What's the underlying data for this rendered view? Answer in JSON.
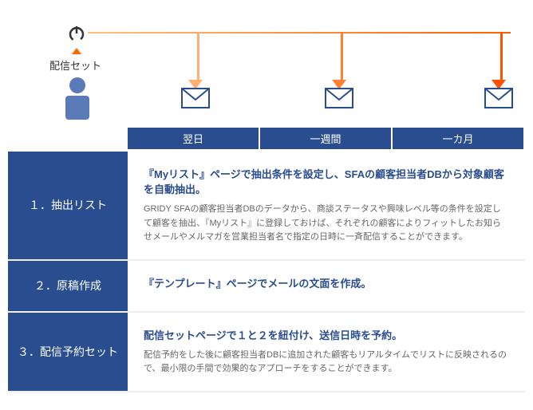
{
  "header": {
    "set_label": "配信セット",
    "timeline": [
      "翌日",
      "一週間",
      "一カ月"
    ]
  },
  "steps": [
    {
      "label": "１．抽出リスト",
      "title": "『Myリスト』ページで抽出条件を設定し、SFAの顧客担当者DBから対象顧客を自動抽出。",
      "desc": "GRIDY SFAの顧客担当者DBのデータから、商談ステータスや興味レベル等の条件を設定して顧客を抽出、『Myリスト』に登録しておけば、それぞれの顧客によりフィットしたお知らせメールやメルマガを営業担当者名で指定の日時に一斉配信することができます。"
    },
    {
      "label": "２．原稿作成",
      "title": "『テンプレート』ページでメールの文面を作成。",
      "desc": ""
    },
    {
      "label": "３．配信予約セット",
      "title": "配信セットページで１と２を紐付け、送信日時を予約。",
      "desc": "配信予約をした後に顧客担当者DBに追加された顧客もリアルタイムでリストに反映されるので、最小限の手間で効果的なアプローチをすることができます。"
    }
  ]
}
